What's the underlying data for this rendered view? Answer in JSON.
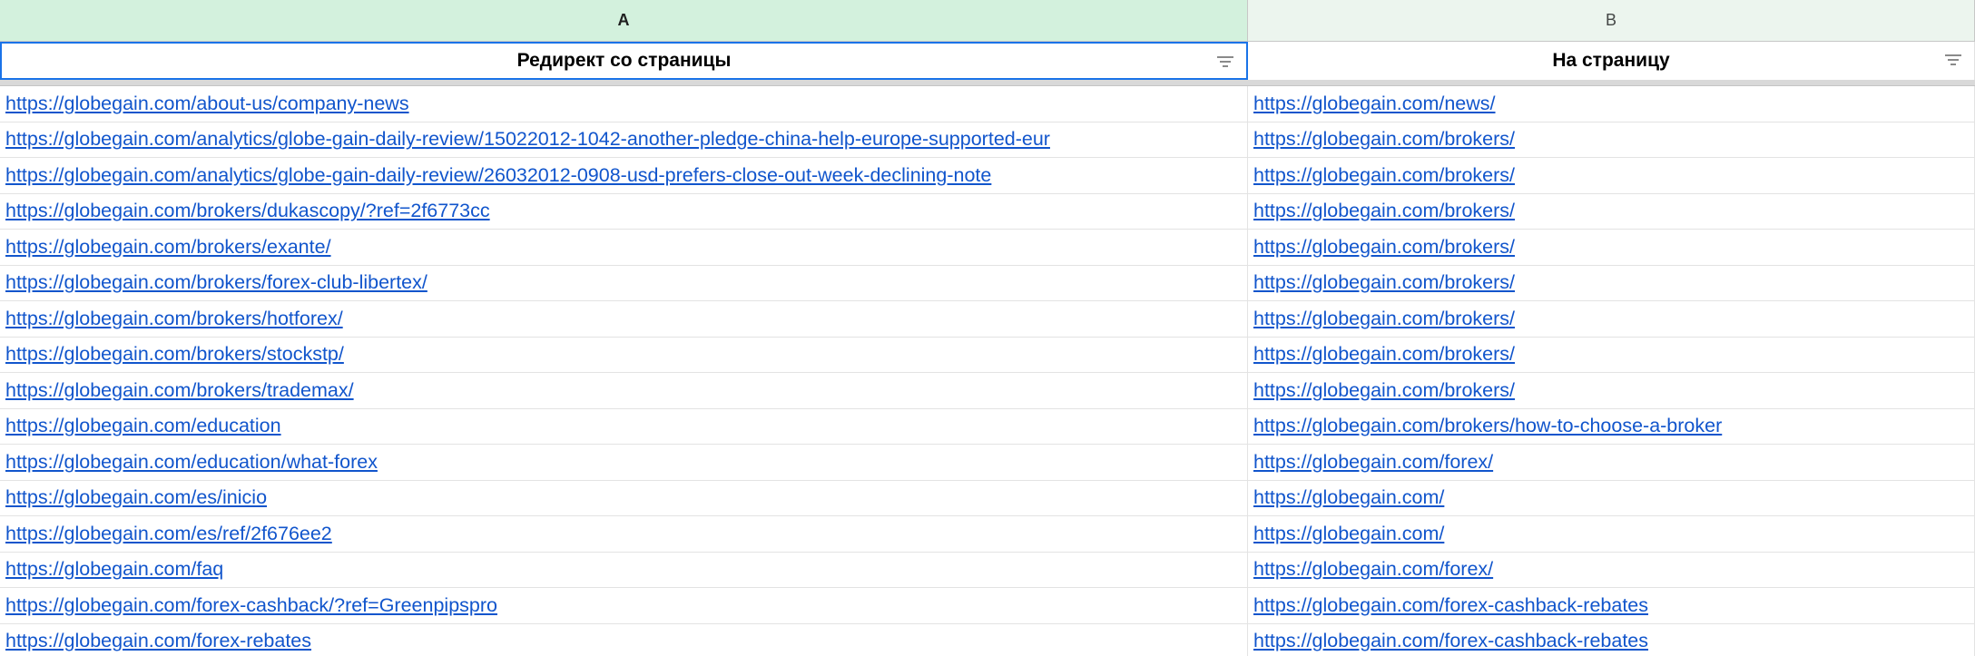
{
  "columns": {
    "a_letter": "A",
    "b_letter": "B"
  },
  "header": {
    "a": "Редирект со страницы",
    "b": "На страницу"
  },
  "rows": [
    {
      "from": "https://globegain.com/about-us/company-news",
      "to": "https://globegain.com/news/"
    },
    {
      "from": "https://globegain.com/analytics/globe-gain-daily-review/15022012-1042-another-pledge-china-help-europe-supported-eur",
      "to": "https://globegain.com/brokers/"
    },
    {
      "from": "https://globegain.com/analytics/globe-gain-daily-review/26032012-0908-usd-prefers-close-out-week-declining-note",
      "to": "https://globegain.com/brokers/"
    },
    {
      "from": "https://globegain.com/brokers/dukascopy/?ref=2f6773cc",
      "to": "https://globegain.com/brokers/"
    },
    {
      "from": "https://globegain.com/brokers/exante/",
      "to": "https://globegain.com/brokers/"
    },
    {
      "from": "https://globegain.com/brokers/forex-club-libertex/",
      "to": "https://globegain.com/brokers/"
    },
    {
      "from": "https://globegain.com/brokers/hotforex/",
      "to": "https://globegain.com/brokers/"
    },
    {
      "from": "https://globegain.com/brokers/stockstp/",
      "to": "https://globegain.com/brokers/"
    },
    {
      "from": "https://globegain.com/brokers/trademax/",
      "to": "https://globegain.com/brokers/"
    },
    {
      "from": "https://globegain.com/education",
      "to": "https://globegain.com/brokers/how-to-choose-a-broker"
    },
    {
      "from": "https://globegain.com/education/what-forex",
      "to": "https://globegain.com/forex/"
    },
    {
      "from": "https://globegain.com/es/inicio",
      "to": "https://globegain.com/"
    },
    {
      "from": "https://globegain.com/es/ref/2f676ee2",
      "to": "https://globegain.com/"
    },
    {
      "from": "https://globegain.com/faq",
      "to": "https://globegain.com/forex/"
    },
    {
      "from": "https://globegain.com/forex-cashback/?ref=Greenpipspro",
      "to": "https://globegain.com/forex-cashback-rebates"
    },
    {
      "from": "https://globegain.com/forex-rebates",
      "to": "https://globegain.com/forex-cashback-rebates"
    }
  ],
  "icons": {
    "filter": "filter-icon"
  }
}
